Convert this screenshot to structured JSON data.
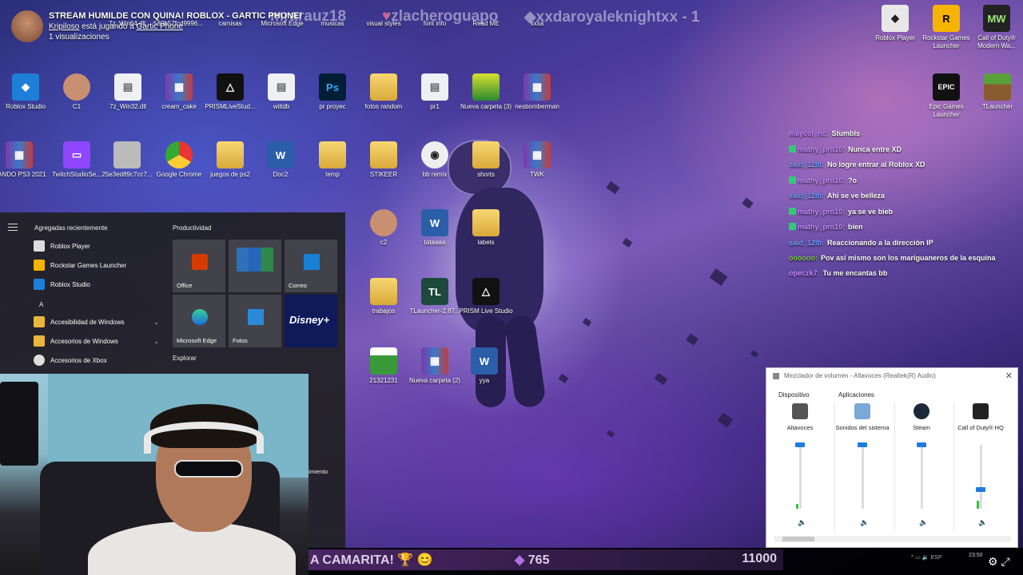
{
  "stream": {
    "title": "STREAM HUMILDE CON QUINA! ROBLOX - GARTIC PHONE!",
    "channel": "Kripiloso",
    "playing_mid": "está jugando a",
    "game": "Gartic Phone",
    "views": "1 visualizaciones",
    "ticker": [
      "mrarauz18",
      "zlacheroguapo",
      "xxdaroyaleknightxx - 1"
    ]
  },
  "desktop_icons": [
    {
      "label": "7z_Win64.dll",
      "kind": "doc"
    },
    {
      "label": "580b57fcd9996...",
      "kind": "doc"
    },
    {
      "label": "camisas",
      "kind": "folder"
    },
    {
      "label": "Microsoft Edge",
      "kind": "edge"
    },
    {
      "label": "musicas",
      "kind": "folder"
    },
    {
      "label": "visual styles",
      "kind": "folder"
    },
    {
      "label": "font info",
      "kind": "doc"
    },
    {
      "label": "Read ME",
      "kind": "doc"
    },
    {
      "label": "xxxa",
      "kind": "folder"
    },
    {
      "label": "Roblox Player",
      "kind": "roblox"
    },
    {
      "label": "Rockstar Games Launcher",
      "kind": "rockstar"
    },
    {
      "label": "Call of Duty® Modern Wa...",
      "kind": "cod"
    },
    {
      "label": "Roblox Studio",
      "kind": "roblox"
    },
    {
      "label": "C1",
      "kind": "photo"
    },
    {
      "label": "7z_Win32.dll",
      "kind": "doc"
    },
    {
      "label": "cream_cake",
      "kind": "winrar"
    },
    {
      "label": "PRISMLiveStud...",
      "kind": "prism"
    },
    {
      "label": "wiitdb",
      "kind": "doc"
    },
    {
      "label": "pr proyec",
      "kind": "ps"
    },
    {
      "label": "fotos random",
      "kind": "folder"
    },
    {
      "label": "pr1",
      "kind": "doc"
    },
    {
      "label": "Nueva carpeta (3)",
      "kind": "folder"
    },
    {
      "label": "nesbomberman",
      "kind": "winrar"
    },
    {
      "label": "Epic Games Launcher",
      "kind": "epic"
    },
    {
      "label": "TLauncher",
      "kind": "tlauncher"
    },
    {
      "label": "MANDO PS3 2021",
      "kind": "winrar"
    },
    {
      "label": "TwitchStudioSe...",
      "kind": "twitch"
    },
    {
      "label": "25e3ed89c7cc7...",
      "kind": "doc"
    },
    {
      "label": "Google Chrome",
      "kind": "chrome"
    },
    {
      "label": "juegos de ps2",
      "kind": "folder"
    },
    {
      "label": "Doc2",
      "kind": "word"
    },
    {
      "label": "temp",
      "kind": "folder"
    },
    {
      "label": "STIKEER",
      "kind": "folder"
    },
    {
      "label": "bb remix",
      "kind": "doc"
    },
    {
      "label": "shorts",
      "kind": "folder"
    },
    {
      "label": "TWK",
      "kind": "winrar"
    },
    {
      "label": "c2",
      "kind": "photo"
    },
    {
      "label": "tataaaa",
      "kind": "word"
    },
    {
      "label": "labels",
      "kind": "folder"
    },
    {
      "label": "trabajos",
      "kind": "folder"
    },
    {
      "label": "TLauncher-2.87...",
      "kind": "tlauncher"
    },
    {
      "label": "PRISM Live Studio",
      "kind": "prism"
    },
    {
      "label": "21321231",
      "kind": "doc"
    },
    {
      "label": "Nueva carpeta (2)",
      "kind": "winrar"
    },
    {
      "label": "yya",
      "kind": "word"
    }
  ],
  "chat": [
    {
      "user": "maycol_nc:",
      "msg": "Stumbls",
      "color": "#c58cff",
      "badge": false
    },
    {
      "user": "mathy_pro10:",
      "msg": "Nunca entre XD",
      "color": "#c58cff",
      "badge": true
    },
    {
      "user": "said_12lb:",
      "msg": "No logre entrar al Roblox XD",
      "color": "#6ea0ff",
      "badge": false
    },
    {
      "user": "mathy_pro10:",
      "msg": "?o",
      "color": "#c58cff",
      "badge": true
    },
    {
      "user": "said_12lb:",
      "msg": "Ahi se ve belleza",
      "color": "#6ea0ff",
      "badge": false
    },
    {
      "user": "mathy_pro10:",
      "msg": "ya se ve bieb",
      "color": "#c58cff",
      "badge": true
    },
    {
      "user": "mathy_pro10:",
      "msg": "bien",
      "color": "#c58cff",
      "badge": true
    },
    {
      "user": "said_12lb:",
      "msg": "Reaccionando a la dirección IP",
      "color": "#6ea0ff",
      "badge": false
    },
    {
      "user": "oooooo:",
      "msg": "Pov así mismo son los mariguaneros de la esquina",
      "color": "#7ac943",
      "badge": false
    },
    {
      "user": "opeczk7:",
      "msg": "Tu me encantas bb",
      "color": "#c58cff",
      "badge": false
    }
  ],
  "start_menu": {
    "recent_header": "Agregadas recientemente",
    "recent": [
      "Roblox Player",
      "Rockstar Games Launcher",
      "Roblox Studio"
    ],
    "letter": "A",
    "apps": [
      {
        "label": "Accesibilidad de Windows",
        "chevron": "⌄"
      },
      {
        "label": "Accesorios de Windows",
        "chevron": "⌄"
      },
      {
        "label": "Accesorios de Xbox",
        "chevron": ""
      }
    ],
    "productivity_header": "Productividad",
    "tiles_row1": [
      "Office",
      "",
      "Correo"
    ],
    "tiles_row2": [
      "Microsoft Edge",
      "Fotos",
      "Disney+"
    ],
    "explore_header": "Explorar",
    "partial_label": "imiento"
  },
  "mixer": {
    "title": "Mezclador de volumen - Altavoces (Realtek(R) Audio)",
    "device_header": "Dispositivo",
    "apps_header": "Aplicaciones",
    "channels": [
      {
        "label": "Altavoces",
        "volume": 1.0,
        "level": 0.08
      },
      {
        "label": "Sonidos del sistema",
        "volume": 1.0,
        "level": 0
      },
      {
        "label": "Steam",
        "volume": 1.0,
        "level": 0
      },
      {
        "label": "Call of Duty® HQ",
        "volume": 0.3,
        "level": 0.12
      }
    ]
  },
  "overlay": {
    "goal_text": "A CAMARITA! 🏆 😊",
    "goal_current": "765",
    "goal_target": "11000"
  },
  "tray": {
    "lang": "ESP",
    "time": "23:50"
  },
  "colors": {
    "accent": "#1f7be0",
    "badge": "#2ecc71"
  }
}
